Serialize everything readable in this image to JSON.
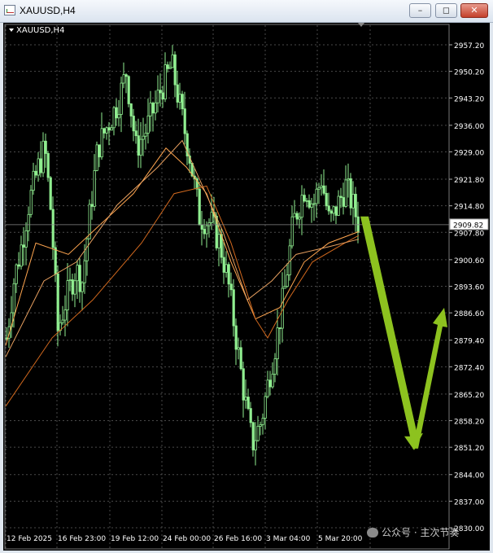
{
  "window": {
    "title": "XAUUSD,H4",
    "controls": [
      "–",
      "◻",
      "✕"
    ]
  },
  "chart": {
    "label": "XAUUSD,H4",
    "current_price": "2909.82",
    "price_levels": [
      "2957.20",
      "2950.20",
      "2943.20",
      "2936.00",
      "2929.00",
      "2921.80",
      "2914.80",
      "2907.80",
      "2900.60",
      "2893.60",
      "2886.60",
      "2879.40",
      "2872.40",
      "2865.20",
      "2858.20",
      "2851.20",
      "2844.00",
      "2837.00",
      "2830.00"
    ],
    "date_labels": [
      "12 Feb 2025",
      "16 Feb 23:00",
      "19 Feb 12:00",
      "24 Feb 00:00",
      "26 Feb 16:00",
      "3 Mar 04:00",
      "5 Mar 20:00"
    ],
    "colors": {
      "background": "#000000",
      "candles": "#90EE90",
      "ma_fast": "#FFA54F",
      "ma_slow": "#D2691E",
      "arrow": "#8DC21F",
      "grid": "#4a4a4a",
      "text": "#FFFFFF"
    }
  },
  "chart_data": {
    "type": "candlestick",
    "symbol": "XAUUSD",
    "timeframe": "H4",
    "ylim": [
      2830.0,
      2960.0
    ],
    "projection_arrows": [
      {
        "from_price": 2912.0,
        "to_price": 2851.5
      },
      {
        "from_price": 2851.5,
        "to_price": 2886.0
      }
    ]
  },
  "watermark": {
    "text": "公众号 · 主次节奏"
  }
}
